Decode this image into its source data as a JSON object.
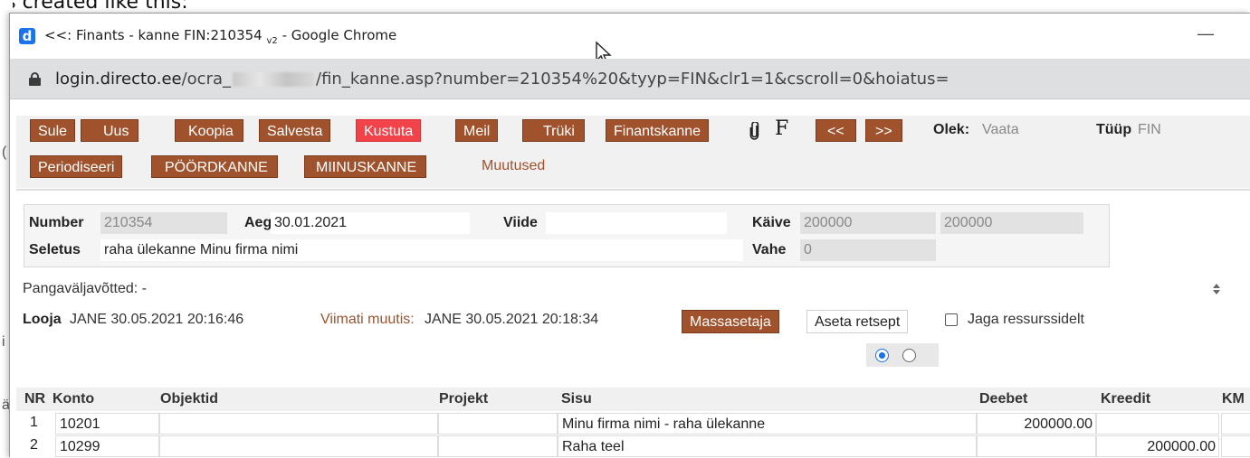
{
  "background": {
    "caption": "is created like this:"
  },
  "window": {
    "title_main": "<<: Finants - kanne FIN:210354",
    "title_sub": "v2",
    "title_app": "- Google Chrome",
    "minimize": "—"
  },
  "address": {
    "host": "login.directo.ee",
    "path_start": "/ocra_",
    "path_end": "/fin_kanne.asp?number=210354%20&tyyp=FIN&clr1=1&cscroll=0&hoiatus="
  },
  "toolbar": {
    "sule": "Sule",
    "uus": "Uus",
    "koopia": "Koopia",
    "salvesta": "Salvesta",
    "kustuta": "Kustuta",
    "meil": "Meil",
    "truki": "Trüki",
    "finantskanne": "Finantskanne",
    "f_label": "F",
    "prev": "<<",
    "next": ">>",
    "olek_label": "Olek:",
    "olek_value": "Vaata",
    "tyyp_label": "Tüüp",
    "tyyp_value": "FIN",
    "periodiseeri": "Periodiseeri",
    "poordkanne": "PÖÖRDKANNE",
    "miinuskanne": "MIINUSKANNE",
    "muutused": "Muutused"
  },
  "header": {
    "number_label": "Number",
    "number_value": "210354",
    "aeg_label": "Aeg",
    "aeg_value": "30.01.2021",
    "viide_label": "Viide",
    "viide_value": "",
    "kaive_label": "Käive",
    "kaive_value1": "200000",
    "kaive_value2": "200000",
    "seletus_label": "Seletus",
    "seletus_value": "raha ülekanne Minu firma nimi",
    "vahe_label": "Vahe",
    "vahe_value": "0"
  },
  "info": {
    "pangavaljavotted": "Pangaväljavõtted: -",
    "looja_label": "Looja",
    "looja_value": "JANE 30.05.2021 20:16:46",
    "viimati_label": "Viimati muutis:",
    "viimati_value": "JANE 30.05.2021 20:18:34",
    "massasetaja": "Massasetaja",
    "aseta_retsept": "Aseta retsept",
    "jaga": "Jaga ressurssidelt"
  },
  "table": {
    "columns": [
      "NR",
      "Konto",
      "Objektid",
      "Projekt",
      "Sisu",
      "Deebet",
      "Kreedit",
      "KM"
    ],
    "rows": [
      {
        "nr": "1",
        "konto": "10201",
        "objektid": "",
        "projekt": "",
        "sisu": "Minu firma nimi -  raha ülekanne",
        "deebet": "200000.00",
        "kreedit": ""
      },
      {
        "nr": "2",
        "konto": "10299",
        "objektid": "",
        "projekt": "",
        "sisu": "Raha teel",
        "deebet": "",
        "kreedit": "200000.00"
      }
    ]
  }
}
